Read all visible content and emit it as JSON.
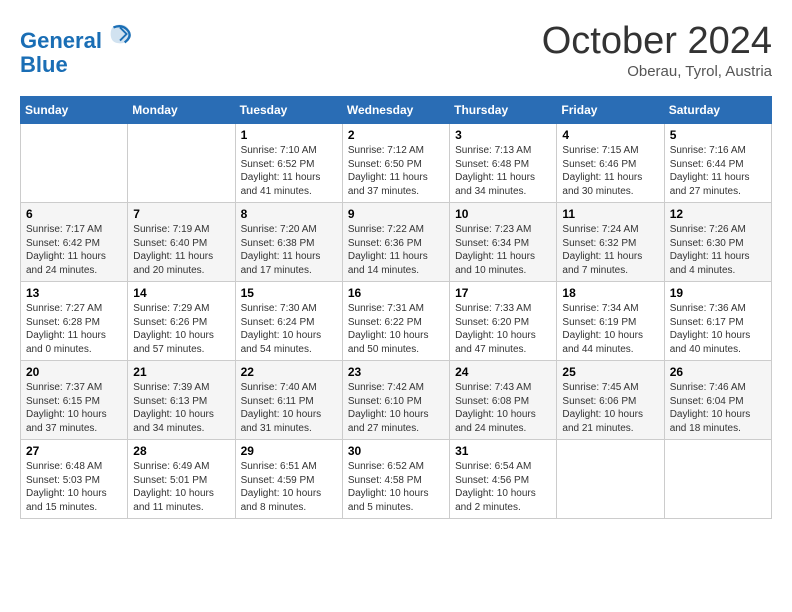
{
  "header": {
    "logo_line1": "General",
    "logo_line2": "Blue",
    "month": "October 2024",
    "location": "Oberau, Tyrol, Austria"
  },
  "days_of_week": [
    "Sunday",
    "Monday",
    "Tuesday",
    "Wednesday",
    "Thursday",
    "Friday",
    "Saturday"
  ],
  "weeks": [
    [
      {
        "num": "",
        "info": ""
      },
      {
        "num": "",
        "info": ""
      },
      {
        "num": "1",
        "info": "Sunrise: 7:10 AM\nSunset: 6:52 PM\nDaylight: 11 hours and 41 minutes."
      },
      {
        "num": "2",
        "info": "Sunrise: 7:12 AM\nSunset: 6:50 PM\nDaylight: 11 hours and 37 minutes."
      },
      {
        "num": "3",
        "info": "Sunrise: 7:13 AM\nSunset: 6:48 PM\nDaylight: 11 hours and 34 minutes."
      },
      {
        "num": "4",
        "info": "Sunrise: 7:15 AM\nSunset: 6:46 PM\nDaylight: 11 hours and 30 minutes."
      },
      {
        "num": "5",
        "info": "Sunrise: 7:16 AM\nSunset: 6:44 PM\nDaylight: 11 hours and 27 minutes."
      }
    ],
    [
      {
        "num": "6",
        "info": "Sunrise: 7:17 AM\nSunset: 6:42 PM\nDaylight: 11 hours and 24 minutes."
      },
      {
        "num": "7",
        "info": "Sunrise: 7:19 AM\nSunset: 6:40 PM\nDaylight: 11 hours and 20 minutes."
      },
      {
        "num": "8",
        "info": "Sunrise: 7:20 AM\nSunset: 6:38 PM\nDaylight: 11 hours and 17 minutes."
      },
      {
        "num": "9",
        "info": "Sunrise: 7:22 AM\nSunset: 6:36 PM\nDaylight: 11 hours and 14 minutes."
      },
      {
        "num": "10",
        "info": "Sunrise: 7:23 AM\nSunset: 6:34 PM\nDaylight: 11 hours and 10 minutes."
      },
      {
        "num": "11",
        "info": "Sunrise: 7:24 AM\nSunset: 6:32 PM\nDaylight: 11 hours and 7 minutes."
      },
      {
        "num": "12",
        "info": "Sunrise: 7:26 AM\nSunset: 6:30 PM\nDaylight: 11 hours and 4 minutes."
      }
    ],
    [
      {
        "num": "13",
        "info": "Sunrise: 7:27 AM\nSunset: 6:28 PM\nDaylight: 11 hours and 0 minutes."
      },
      {
        "num": "14",
        "info": "Sunrise: 7:29 AM\nSunset: 6:26 PM\nDaylight: 10 hours and 57 minutes."
      },
      {
        "num": "15",
        "info": "Sunrise: 7:30 AM\nSunset: 6:24 PM\nDaylight: 10 hours and 54 minutes."
      },
      {
        "num": "16",
        "info": "Sunrise: 7:31 AM\nSunset: 6:22 PM\nDaylight: 10 hours and 50 minutes."
      },
      {
        "num": "17",
        "info": "Sunrise: 7:33 AM\nSunset: 6:20 PM\nDaylight: 10 hours and 47 minutes."
      },
      {
        "num": "18",
        "info": "Sunrise: 7:34 AM\nSunset: 6:19 PM\nDaylight: 10 hours and 44 minutes."
      },
      {
        "num": "19",
        "info": "Sunrise: 7:36 AM\nSunset: 6:17 PM\nDaylight: 10 hours and 40 minutes."
      }
    ],
    [
      {
        "num": "20",
        "info": "Sunrise: 7:37 AM\nSunset: 6:15 PM\nDaylight: 10 hours and 37 minutes."
      },
      {
        "num": "21",
        "info": "Sunrise: 7:39 AM\nSunset: 6:13 PM\nDaylight: 10 hours and 34 minutes."
      },
      {
        "num": "22",
        "info": "Sunrise: 7:40 AM\nSunset: 6:11 PM\nDaylight: 10 hours and 31 minutes."
      },
      {
        "num": "23",
        "info": "Sunrise: 7:42 AM\nSunset: 6:10 PM\nDaylight: 10 hours and 27 minutes."
      },
      {
        "num": "24",
        "info": "Sunrise: 7:43 AM\nSunset: 6:08 PM\nDaylight: 10 hours and 24 minutes."
      },
      {
        "num": "25",
        "info": "Sunrise: 7:45 AM\nSunset: 6:06 PM\nDaylight: 10 hours and 21 minutes."
      },
      {
        "num": "26",
        "info": "Sunrise: 7:46 AM\nSunset: 6:04 PM\nDaylight: 10 hours and 18 minutes."
      }
    ],
    [
      {
        "num": "27",
        "info": "Sunrise: 6:48 AM\nSunset: 5:03 PM\nDaylight: 10 hours and 15 minutes."
      },
      {
        "num": "28",
        "info": "Sunrise: 6:49 AM\nSunset: 5:01 PM\nDaylight: 10 hours and 11 minutes."
      },
      {
        "num": "29",
        "info": "Sunrise: 6:51 AM\nSunset: 4:59 PM\nDaylight: 10 hours and 8 minutes."
      },
      {
        "num": "30",
        "info": "Sunrise: 6:52 AM\nSunset: 4:58 PM\nDaylight: 10 hours and 5 minutes."
      },
      {
        "num": "31",
        "info": "Sunrise: 6:54 AM\nSunset: 4:56 PM\nDaylight: 10 hours and 2 minutes."
      },
      {
        "num": "",
        "info": ""
      },
      {
        "num": "",
        "info": ""
      }
    ]
  ]
}
